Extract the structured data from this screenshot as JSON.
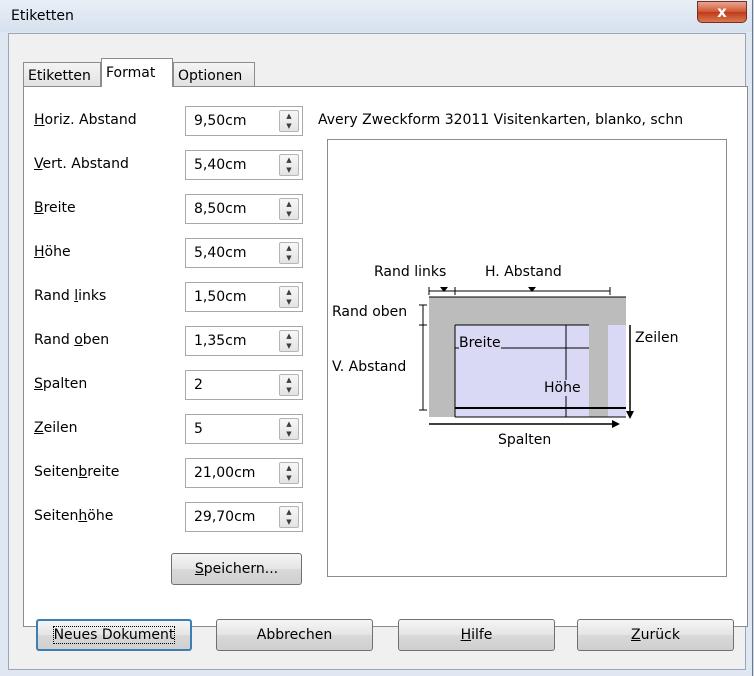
{
  "window": {
    "title": "Etiketten",
    "close_glyph": "x"
  },
  "tabs": [
    {
      "label": "Etiketten",
      "active": false
    },
    {
      "label": "Format",
      "active": true
    },
    {
      "label": "Optionen",
      "active": false
    }
  ],
  "fields": [
    {
      "label_pre": "",
      "label_key": "H",
      "label_post": "oriz. Abstand",
      "value": "9,50cm"
    },
    {
      "label_pre": "",
      "label_key": "V",
      "label_post": "ert. Abstand",
      "value": "5,40cm"
    },
    {
      "label_pre": "",
      "label_key": "B",
      "label_post": "reite",
      "value": "8,50cm"
    },
    {
      "label_pre": "",
      "label_key": "H",
      "label_post": "öhe",
      "value": "5,40cm"
    },
    {
      "label_pre": "Rand ",
      "label_key": "l",
      "label_post": "inks",
      "value": "1,50cm"
    },
    {
      "label_pre": "Rand ",
      "label_key": "o",
      "label_post": "ben",
      "value": "1,35cm"
    },
    {
      "label_pre": "",
      "label_key": "S",
      "label_post": "palten",
      "value": "2"
    },
    {
      "label_pre": "",
      "label_key": "Z",
      "label_post": "eilen",
      "value": "5"
    },
    {
      "label_pre": "Seiten",
      "label_key": "b",
      "label_post": "reite",
      "value": "21,00cm"
    },
    {
      "label_pre": "Seiten",
      "label_key": "h",
      "label_post": "öhe",
      "value": "29,70cm"
    }
  ],
  "save_button": {
    "key": "S",
    "rest": "peichern..."
  },
  "product": "Avery Zweckform   32011 Visitenkarten, blanko, schn",
  "diagram": {
    "rand_links": "Rand links",
    "h_abstand": "H. Abstand",
    "rand_oben": "Rand oben",
    "v_abstand": "V. Abstand",
    "breite": "Breite",
    "hoehe": "Höhe",
    "zeilen": "Zeilen",
    "spalten": "Spalten",
    "page_color": "#bcbcbc",
    "label_color": "#d9d9f5"
  },
  "buttons": {
    "neues_dokument": "Neues Dokument",
    "abbrechen": "Abbrechen",
    "hilfe_key": "H",
    "hilfe_rest": "ilfe",
    "zurueck_key": "Z",
    "zurueck_rest": "urück"
  }
}
